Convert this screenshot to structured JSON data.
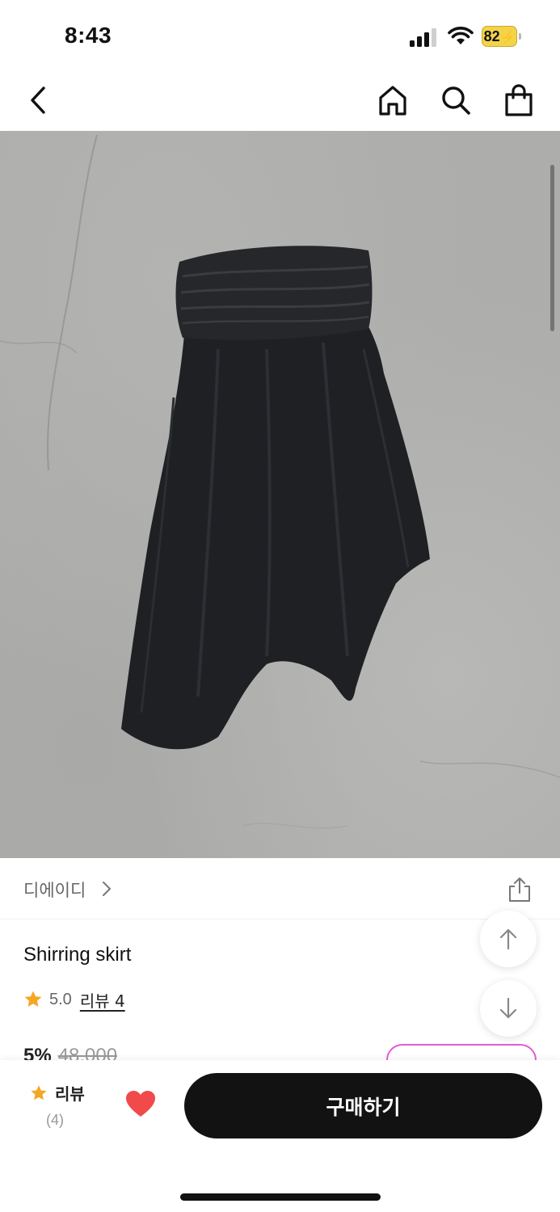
{
  "status_bar": {
    "time": "8:43",
    "battery_level": "82",
    "battery_color": "#f3d34a",
    "icons": [
      "cellular-signal-icon",
      "wifi-icon",
      "battery-charging-icon"
    ]
  },
  "nav": {
    "icons": [
      "back-arrow-icon",
      "home-icon",
      "search-icon",
      "shopping-bag-icon"
    ]
  },
  "product": {
    "image_icon": "product-photo-black-shirring-skirt",
    "brand": "디에이디",
    "name": "Shirring skirt",
    "rating": "5.0",
    "review_link": "리뷰 4",
    "discount": "5%",
    "original_price": "48,000"
  },
  "bottom_bar": {
    "review_label": "리뷰",
    "review_count": "(4)",
    "buy_label": "구매하기",
    "heart_color": "#f04a4a",
    "buy_button_color": "#121212"
  },
  "colors": {
    "star": "#f5a623",
    "coupon_border": "#e85bd2"
  }
}
